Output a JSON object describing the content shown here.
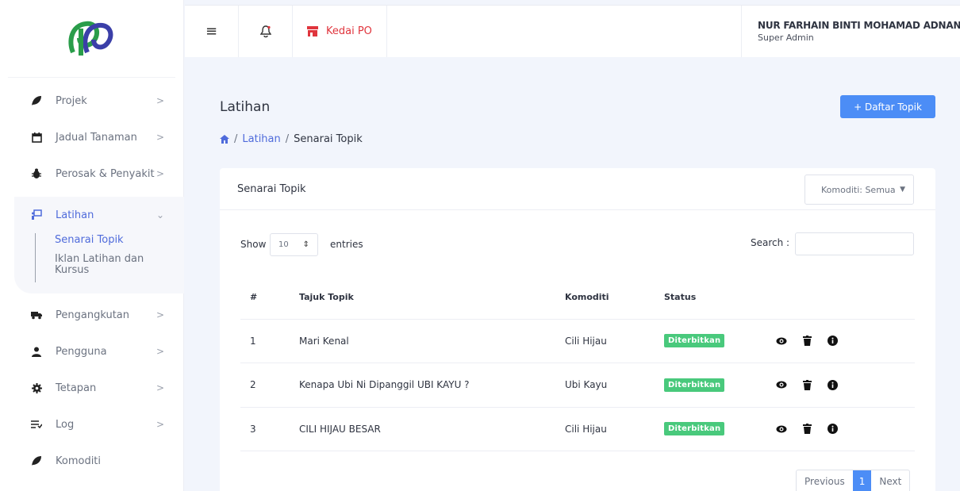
{
  "sidebar": {
    "items_top": [
      {
        "label": "Projek",
        "icon": "leaf-icon"
      },
      {
        "label": "Jadual Tanaman",
        "icon": "calendar-icon"
      },
      {
        "label": "Perosak & Penyakit",
        "icon": "bug-icon"
      }
    ],
    "group": {
      "label": "Latihan",
      "icon": "presentation-icon",
      "subitems": [
        "Senarai Topik",
        "Iklan Latihan dan Kursus"
      ]
    },
    "items_bottom": [
      {
        "label": "Pengangkutan",
        "icon": "truck-icon"
      },
      {
        "label": "Pengguna",
        "icon": "user-icon"
      },
      {
        "label": "Tetapan",
        "icon": "gear-icon"
      },
      {
        "label": "Log",
        "icon": "log-icon"
      },
      {
        "label": "Komoditi",
        "icon": "leaf-icon"
      }
    ]
  },
  "topbar": {
    "shop_label": "Kedai PO",
    "user_name": "NUR FARHAIN BINTI MOHAMAD ADNAN",
    "user_role": "Super Admin"
  },
  "main": {
    "title": "Latihan",
    "add_button": "+ Daftar Topik",
    "breadcrumb": {
      "link": "Latihan",
      "separator": "/",
      "current": "Senarai Topik"
    }
  },
  "card": {
    "title": "Senarai Topik",
    "filter": "Komoditi: Semua",
    "show_label": "Show",
    "page_size": "10",
    "entries_label": "entries",
    "search_label": "Search :",
    "columns": [
      "#",
      "Tajuk Topik",
      "Komoditi",
      "Status"
    ],
    "rows": [
      {
        "no": "1",
        "title": "Mari Kenal",
        "komoditi": "Cili Hijau",
        "status": "Diterbitkan"
      },
      {
        "no": "2",
        "title": "Kenapa Ubi Ni Dipanggil UBI KAYU ?",
        "komoditi": "Ubi Kayu",
        "status": "Diterbitkan"
      },
      {
        "no": "3",
        "title": "CILI HIJAU BESAR",
        "komoditi": "Cili Hijau",
        "status": "Diterbitkan"
      }
    ],
    "pager": {
      "prev": "Previous",
      "page": "1",
      "next": "Next"
    }
  },
  "colors": {
    "accent": "#4c8df6",
    "link": "#4f6bdb",
    "badge": "#49c97c",
    "shop": "#e0353d"
  }
}
